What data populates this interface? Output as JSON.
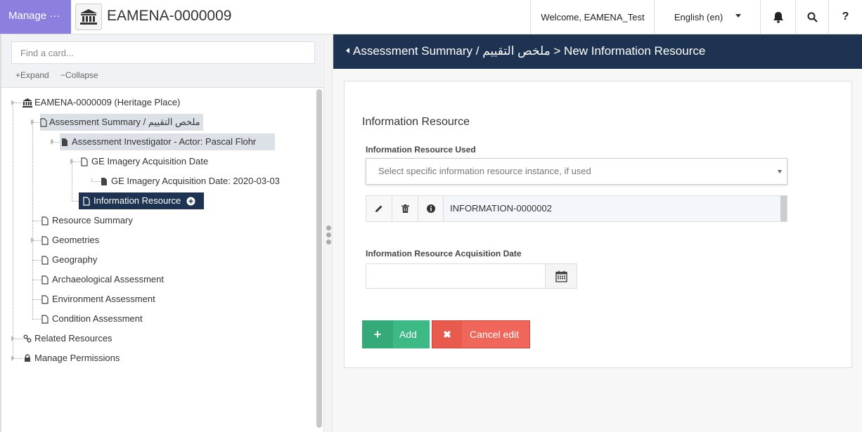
{
  "topbar": {
    "manage_label": "Manage ···",
    "resource_icon": "museum-icon",
    "resource_title": "EAMENA-0000009",
    "welcome": "Welcome, EAMENA_Test",
    "language": "English (en)",
    "help_label": "?"
  },
  "left_panel": {
    "find_placeholder": "Find a card...",
    "expand_label": "Expand",
    "collapse_label": "Collapse",
    "tree": {
      "root": "EAMENA-0000009 (Heritage Place)",
      "assessment_summary": "Assessment Summary / ملخص التقييم",
      "investigator": "Assessment Investigator - Actor: Pascal Flohr",
      "ge_date": "GE Imagery Acquisition Date",
      "ge_date_value": "GE Imagery Acquisition Date: 2020-03-03",
      "info_resource": "Information Resource",
      "resource_summary": "Resource Summary",
      "geometries": "Geometries",
      "geography": "Geography",
      "archaeological": "Archaeological Assessment",
      "environment": "Environment Assessment",
      "condition": "Condition Assessment",
      "related": "Related Resources",
      "permissions": "Manage Permissions"
    }
  },
  "right_panel": {
    "breadcrumb": "Assessment Summary / ملخص التقييم > New Information Resource",
    "card_title": "Information Resource",
    "resource_used_label": "Information Resource Used",
    "select_placeholder": "Select specific information resource instance, if used",
    "selected_value": "INFORMATION-0000002",
    "acq_date_label": "Information Resource Acquisition Date",
    "add_label": "Add",
    "cancel_label": "Cancel edit"
  },
  "colors": {
    "manage_bg": "#8b7fe0",
    "header_navy": "#1e3352",
    "add_green": "#3cb985",
    "cancel_red": "#f0665a"
  }
}
